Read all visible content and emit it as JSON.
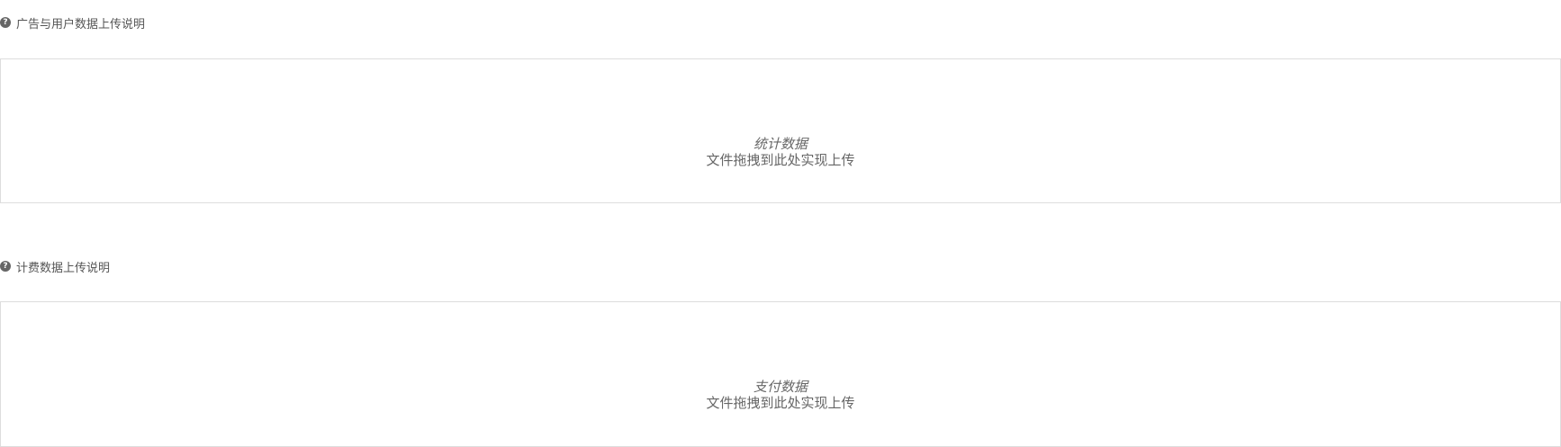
{
  "sections": [
    {
      "label": "广告与用户数据上传说明",
      "help_icon": "question-circle-icon",
      "dropzone": {
        "title": "统计数据",
        "hint": "文件拖拽到此处实现上传"
      }
    },
    {
      "label": "计费数据上传说明",
      "help_icon": "question-circle-icon",
      "dropzone": {
        "title": "支付数据",
        "hint": "文件拖拽到此处实现上传"
      }
    }
  ]
}
